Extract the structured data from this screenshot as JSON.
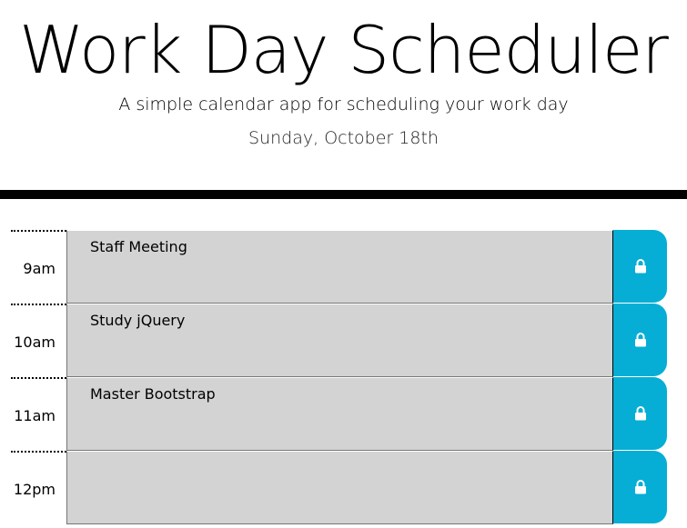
{
  "header": {
    "title": "Work Day Scheduler",
    "subtitle": "A simple calendar app for scheduling your work day",
    "current_day": "Sunday, October 18th"
  },
  "colors": {
    "past": "#d3d3d3",
    "save_button": "#06aed5",
    "divider": "#000000"
  },
  "timeblocks": [
    {
      "hour": "9am",
      "text": "Staff Meeting",
      "save_icon": "lock-icon"
    },
    {
      "hour": "10am",
      "text": "Study jQuery",
      "save_icon": "lock-icon"
    },
    {
      "hour": "11am",
      "text": "Master Bootstrap",
      "save_icon": "lock-icon"
    },
    {
      "hour": "12pm",
      "text": "",
      "save_icon": "lock-icon"
    }
  ]
}
